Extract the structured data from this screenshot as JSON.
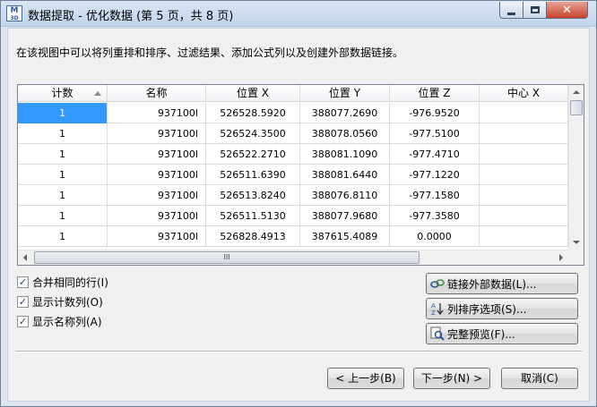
{
  "window": {
    "icon_text_top": "M",
    "icon_text_bottom": "3D",
    "title": "数据提取 - 优化数据 (第 5 页，共 8 页)"
  },
  "description": "在该视图中可以将列重排和排序、过滤结果、添加公式列以及创建外部数据链接。",
  "grid": {
    "columns": [
      "计数",
      "名称",
      "位置 X",
      "位置 Y",
      "位置 Z",
      "中心 X"
    ],
    "sorted_column": "计数",
    "rows": [
      [
        "1",
        "937100l",
        "526528.5920",
        "388077.2690",
        "-976.9520",
        ""
      ],
      [
        "1",
        "937100l",
        "526524.3500",
        "388078.0560",
        "-977.5100",
        ""
      ],
      [
        "1",
        "937100l",
        "526522.2710",
        "388081.1090",
        "-977.4710",
        ""
      ],
      [
        "1",
        "937100l",
        "526511.6390",
        "388081.6440",
        "-977.1220",
        ""
      ],
      [
        "1",
        "937100l",
        "526513.8240",
        "388076.8110",
        "-977.1580",
        ""
      ],
      [
        "1",
        "937100l",
        "526511.5130",
        "388077.9680",
        "-977.3580",
        ""
      ],
      [
        "1",
        "937100l",
        "526828.4913",
        "387615.4089",
        "0.0000",
        ""
      ]
    ],
    "selected_row": 0,
    "hscroll_grip": "III"
  },
  "options": {
    "merge_rows": {
      "label": "合并相同的行(I)",
      "checked": true
    },
    "show_count": {
      "label": "显示计数列(O)",
      "checked": true
    },
    "show_name": {
      "label": "显示名称列(A)",
      "checked": true
    }
  },
  "side_buttons": {
    "link_external": "链接外部数据(L)...",
    "sort_options": "列排序选项(S)...",
    "full_preview": "完整预览(F)..."
  },
  "nav": {
    "back": "< 上一步(B)",
    "next": "下一步(N) >",
    "cancel": "取消(C)"
  },
  "icons": {
    "link": "link-icon",
    "sort": "sort-icon",
    "preview": "preview-icon",
    "check": "✓"
  }
}
